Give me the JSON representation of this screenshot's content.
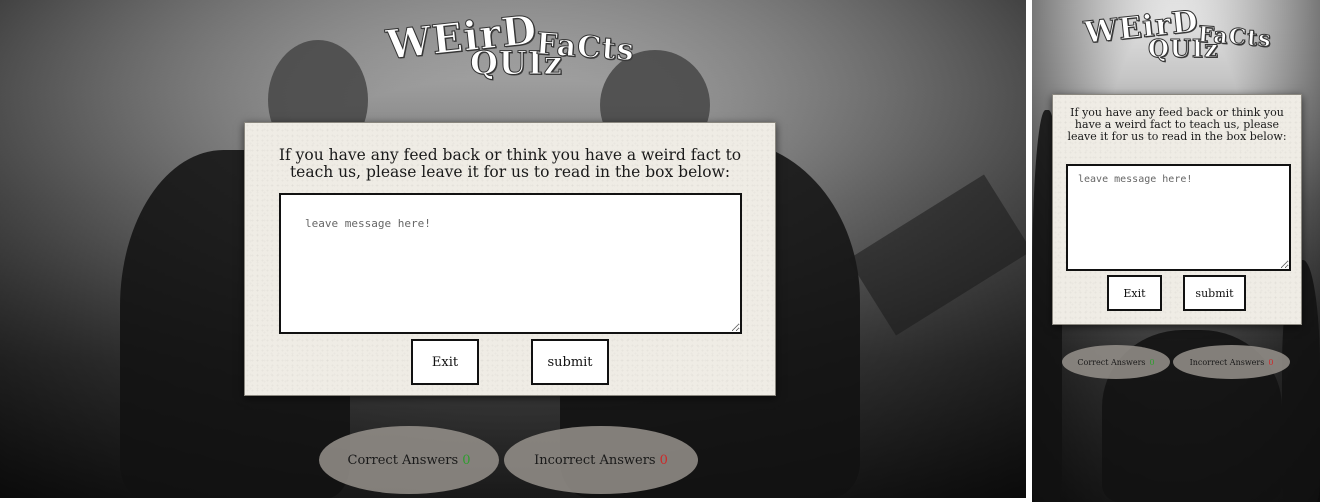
{
  "logo": {
    "word_weird": "WEirD",
    "word_quiz": "QUIz",
    "word_facts": "FaCts"
  },
  "feedback": {
    "prompt": "If you have any feed back or think you have a weird fact to teach us, please leave it for us to read in the box below:",
    "message_placeholder": "leave message here!",
    "message_value": ""
  },
  "buttons": {
    "exit_label": "Exit",
    "submit_label": "submit"
  },
  "scores": {
    "correct_label": "Correct Answers",
    "correct_value": "0",
    "incorrect_label": "Incorrect Answers",
    "incorrect_value": "0"
  },
  "colors": {
    "correct_value": "#2e9e2e",
    "incorrect_value": "#cc2a2a",
    "card_background": "#efece5",
    "score_pill": "#96928c"
  }
}
